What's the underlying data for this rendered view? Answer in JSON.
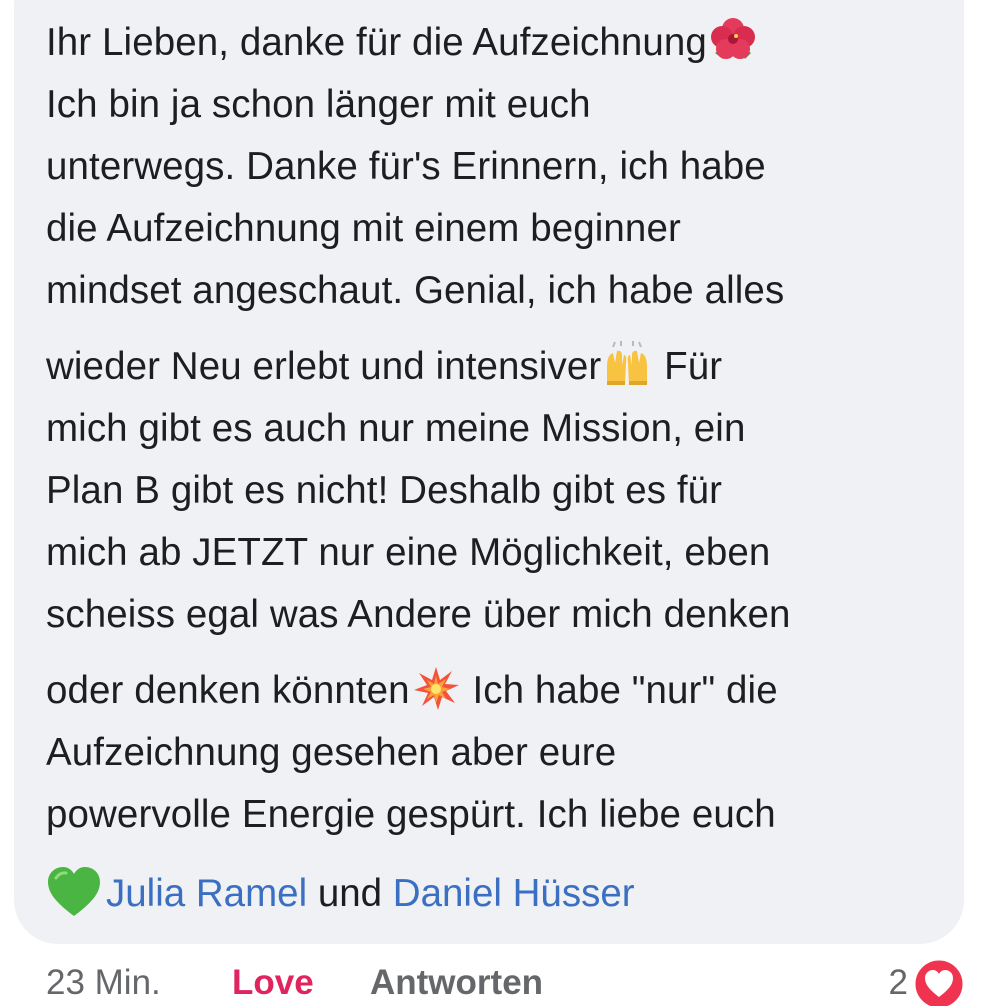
{
  "comment": {
    "lines": [
      "Ihr Lieben, danke für die Aufzeichnung",
      "Ich bin ja schon länger mit euch",
      "unterwegs. Danke für's Erinnern, ich habe",
      "die Aufzeichnung mit einem beginner",
      "mindset angeschaut. Genial, ich habe alles",
      "wieder Neu erlebt und intensiver",
      " Für",
      "mich gibt es auch nur meine Mission, ein",
      "Plan B gibt es nicht! Deshalb gibt es für",
      "mich ab JETZT nur eine Möglichkeit, eben",
      "scheiss egal was Andere über mich denken",
      "oder denken könnten",
      " Ich habe \"nur\" die",
      "Aufzeichnung gesehen aber eure",
      "powervolle Energie gespürt. Ich liebe euch"
    ],
    "emojis": {
      "flower": "hibiscus-icon",
      "hands": "raising-hands-icon",
      "burst": "collision-icon",
      "heart": "green-heart-icon"
    }
  },
  "mentions": {
    "first": "Julia Ramel",
    "joiner": " und ",
    "second": "Daniel Hüsser"
  },
  "footer": {
    "time": "23 Min.",
    "love": "Love",
    "reply": "Antworten",
    "reaction_count": "2"
  },
  "colors": {
    "bubble": "#eff1f4",
    "text": "#1c1e21",
    "mention": "#3b6fc2",
    "love": "#e0245e",
    "meta": "#65676b"
  }
}
